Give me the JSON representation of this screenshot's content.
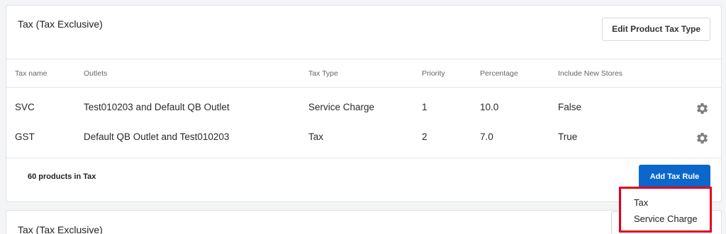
{
  "card1": {
    "title": "Tax (Tax Exclusive)",
    "edit_button": "Edit Product Tax Type",
    "columns": [
      "Tax name",
      "Outlets",
      "Tax Type",
      "Priority",
      "Percentage",
      "Include New Stores"
    ],
    "rows": [
      {
        "name": "SVC",
        "outlets": "Test010203 and Default QB Outlet",
        "type": "Service Charge",
        "priority": "1",
        "percentage": "10.0",
        "include_new_stores": "False"
      },
      {
        "name": "GST",
        "outlets": "Default QB Outlet and Test010203",
        "type": "Tax",
        "priority": "2",
        "percentage": "7.0",
        "include_new_stores": "True"
      }
    ],
    "product_count": "60 products in Tax",
    "add_button": "Add Tax Rule"
  },
  "dropdown": {
    "items": [
      "Tax",
      "Service Charge"
    ],
    "highlight_color": "#e3001b"
  },
  "card2": {
    "title": "Tax (Tax Exclusive)"
  },
  "colors": {
    "primary_button": "#0b67cc"
  },
  "icons": {
    "row_action": "gear-icon"
  }
}
